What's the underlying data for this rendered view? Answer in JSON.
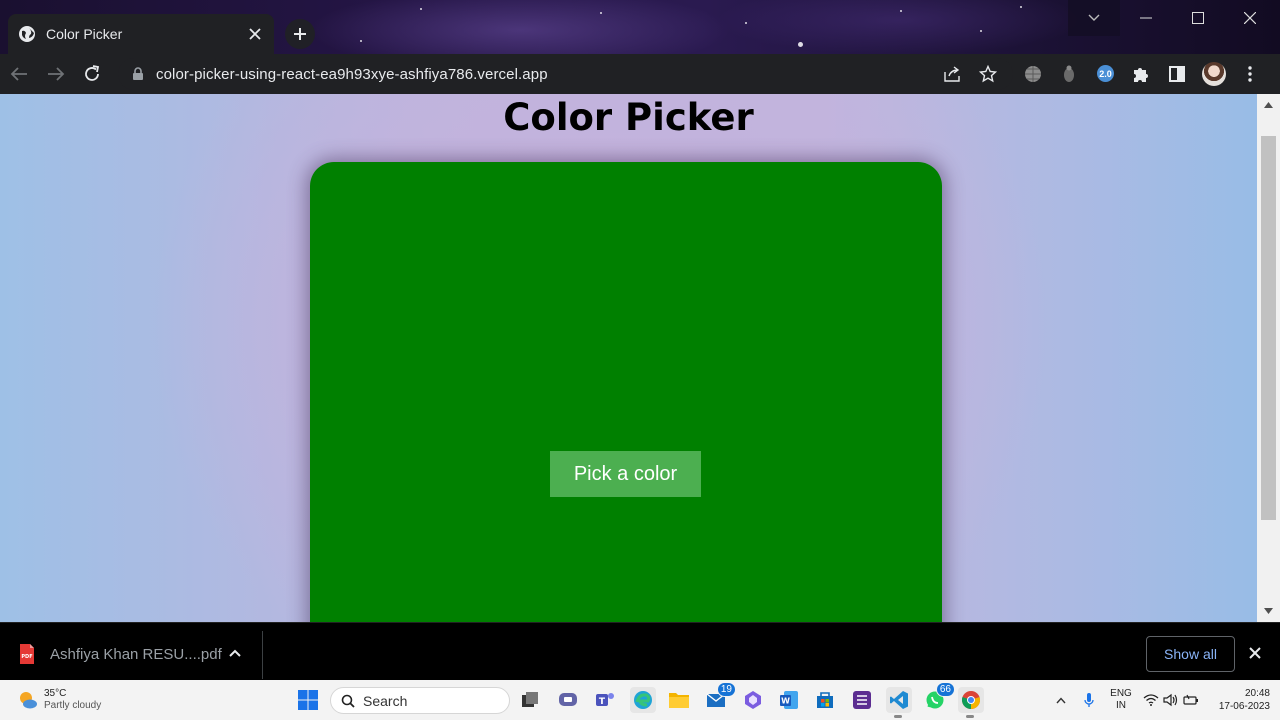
{
  "browser": {
    "tab_title": "Color Picker",
    "url": "color-picker-using-react-ea9h93xye-ashfiya786.vercel.app",
    "extension_badge": "2.0"
  },
  "page": {
    "title": "Color Picker",
    "button_label": "Pick a color",
    "card_color": "#008000",
    "button_color": "#4caf50"
  },
  "downloads": {
    "file_name": "Ashfiya Khan RESU....pdf",
    "file_type_label": "PDF",
    "show_all_label": "Show all"
  },
  "taskbar": {
    "weather_temp": "35°C",
    "weather_desc": "Partly cloudy",
    "search_placeholder": "Search",
    "mail_badge": "19",
    "whatsapp_badge": "66",
    "lang_line1": "ENG",
    "lang_line2": "IN",
    "time": "20:48",
    "date": "17-06-2023"
  }
}
